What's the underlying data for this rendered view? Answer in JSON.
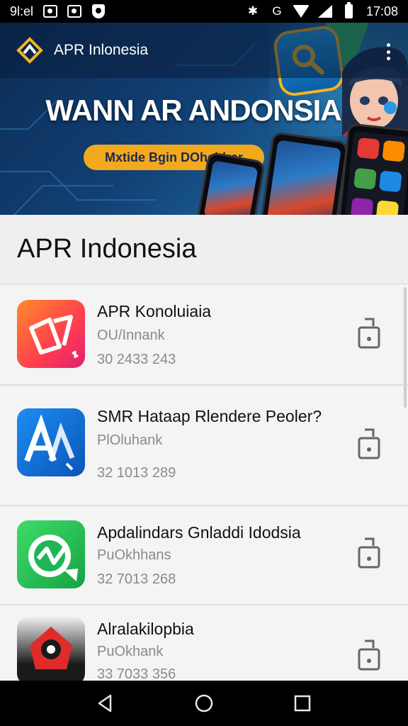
{
  "status_bar": {
    "time_left": "9l:el",
    "time_right": "17:08",
    "icons_left": [
      "gallery-icon",
      "instagram-icon",
      "shield-icon"
    ],
    "icons_right": [
      "bluetooth-icon",
      "google-icon",
      "wifi-icon",
      "signal-icon",
      "battery-icon"
    ]
  },
  "header": {
    "app_title": "APR Inlonesia"
  },
  "banner": {
    "headline": "WANN AR ANDONSIA",
    "pill_text": "Mxtide Bgin DOhchlrar"
  },
  "section": {
    "title": "APR Indonesia"
  },
  "apps": [
    {
      "name": "APR Konoluiaia",
      "subtitle": "OU/Innank",
      "size": "30 2433 243",
      "icon": "app-icon-orange-gradient",
      "accent": "#ff5a3c"
    },
    {
      "name": "SMR Hataap Rlendere Peoler?",
      "subtitle": "PlOluhank",
      "size": "32 1013 289",
      "icon": "app-icon-blue-A",
      "accent": "#1a73e8"
    },
    {
      "name": "Apdalindars Gnladdi Idodsia",
      "subtitle": "PuOkhhans",
      "size": "32 7013 268",
      "icon": "app-icon-green-check",
      "accent": "#2fbf56"
    },
    {
      "name": "Alralakilopbia",
      "subtitle": "PuOkhank",
      "size": "33 7033 356",
      "icon": "app-icon-red-black",
      "accent": "#e02b2b"
    }
  ],
  "nav": {
    "back": "back-icon",
    "home": "home-icon",
    "recents": "recents-icon"
  }
}
